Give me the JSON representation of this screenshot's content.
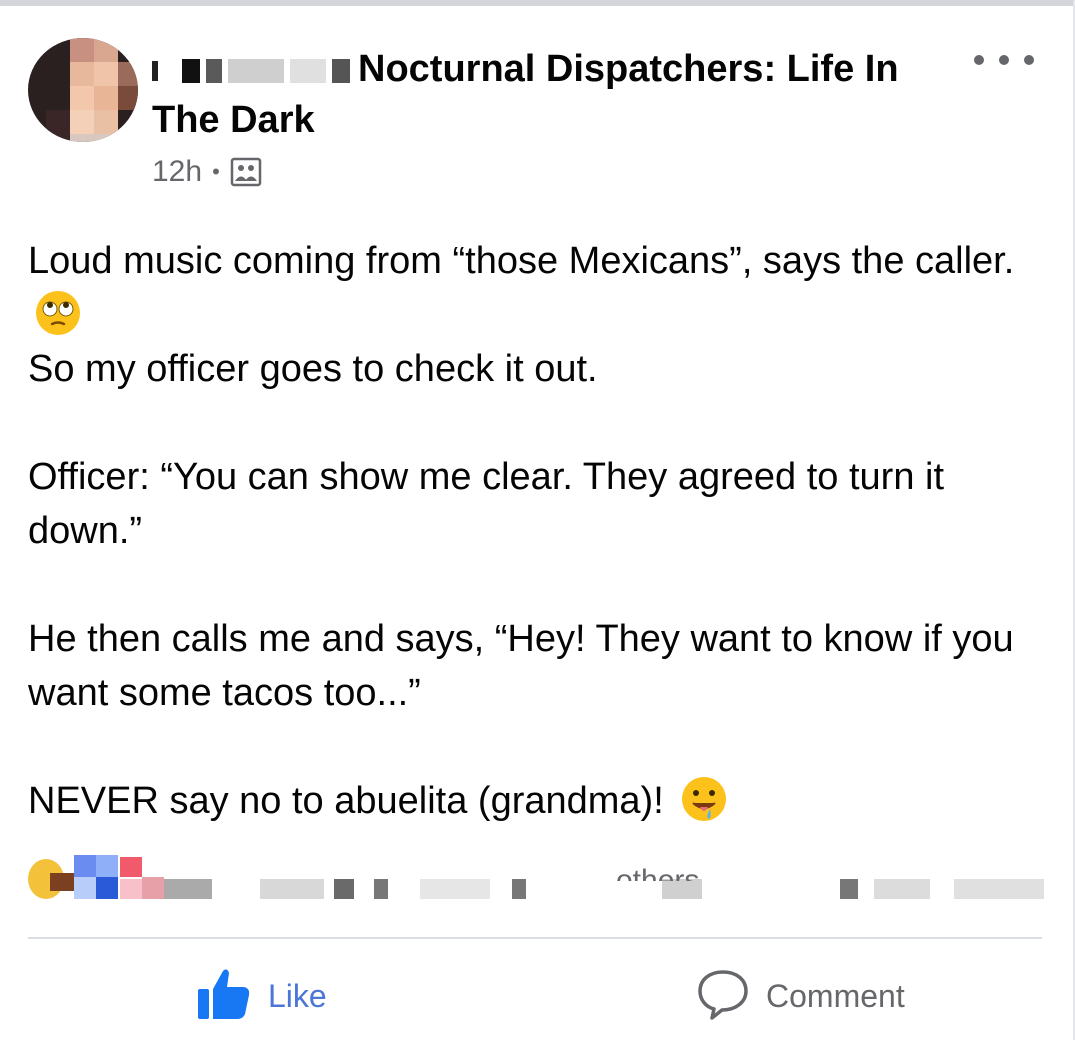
{
  "post": {
    "group_name": "Nocturnal Dispatchers: Life In The Dark",
    "timestamp": "12h",
    "separator": "•",
    "body": [
      "Loud music coming from “those Mexicans”, says the caller.",
      "So my officer goes to check it out.",
      "Officer: “You can show me clear. They agreed to turn it down.”",
      "He then calls me and says, “Hey! They want to know if you want some tacos too...”",
      "NEVER say no to abuelita (grandma)!"
    ],
    "emojis": [
      "face-with-rolling-eyes-emoji",
      "drooling-face-emoji"
    ]
  },
  "reactions": {
    "others_text": "others",
    "icons": [
      "haha-reaction-icon",
      "like-reaction-icon",
      "love-reaction-icon"
    ]
  },
  "actions": {
    "like_label": "Like",
    "comment_label": "Comment"
  },
  "colors": {
    "like_blue": "#4a76d8",
    "secondary_text": "#65676b",
    "divider": "#dadde1"
  }
}
